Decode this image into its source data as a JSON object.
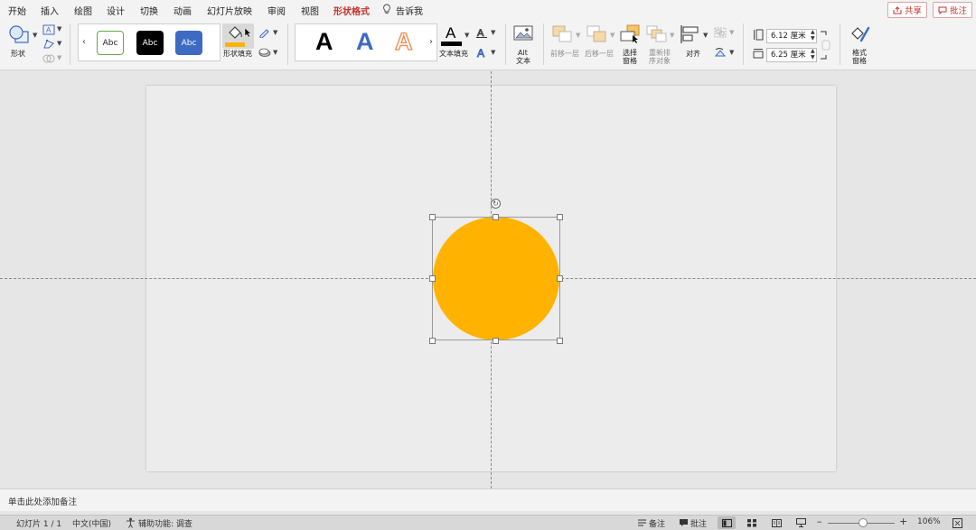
{
  "tabs": [
    {
      "label": "开始",
      "active": false
    },
    {
      "label": "插入",
      "active": false
    },
    {
      "label": "绘图",
      "active": false
    },
    {
      "label": "设计",
      "active": false
    },
    {
      "label": "切换",
      "active": false
    },
    {
      "label": "动画",
      "active": false
    },
    {
      "label": "幻灯片放映",
      "active": false
    },
    {
      "label": "审阅",
      "active": false
    },
    {
      "label": "视图",
      "active": false
    },
    {
      "label": "形状格式",
      "active": true
    }
  ],
  "tell_me": "告诉我",
  "share_label": "共享",
  "comment_label": "批注",
  "ribbon": {
    "shapes_label": "形状",
    "style_samples": [
      "Abc",
      "Abc",
      "Abc"
    ],
    "shape_fill_label": "形状填充",
    "wordart_samples": [
      "A",
      "A",
      "A"
    ],
    "text_fill_label": "文本填充",
    "alt_text_label_1": "Alt",
    "alt_text_label_2": "文本",
    "bring_forward_label": "前移一层",
    "send_backward_label": "后移一层",
    "selection_pane_label_1": "选择",
    "selection_pane_label_2": "窗格",
    "reorder_label_1": "重新排",
    "reorder_label_2": "序对象",
    "align_label": "对齐",
    "height_value": "6.12 厘米",
    "width_value": "6.25 厘米",
    "format_pane_label_1": "格式",
    "format_pane_label_2": "窗格"
  },
  "colors": {
    "accent": "#c4322c",
    "shape_fill": "#ffb300",
    "style_blue": "#3d6bc4",
    "wordart_orange": "#f08a4b"
  },
  "notes_placeholder": "单击此处添加备注",
  "status": {
    "slide_info": "幻灯片 1 / 1",
    "language": "中文(中国)",
    "accessibility": "辅助功能: 调查",
    "notes_label": "备注",
    "comments_label": "批注",
    "zoom_level": "106%"
  }
}
